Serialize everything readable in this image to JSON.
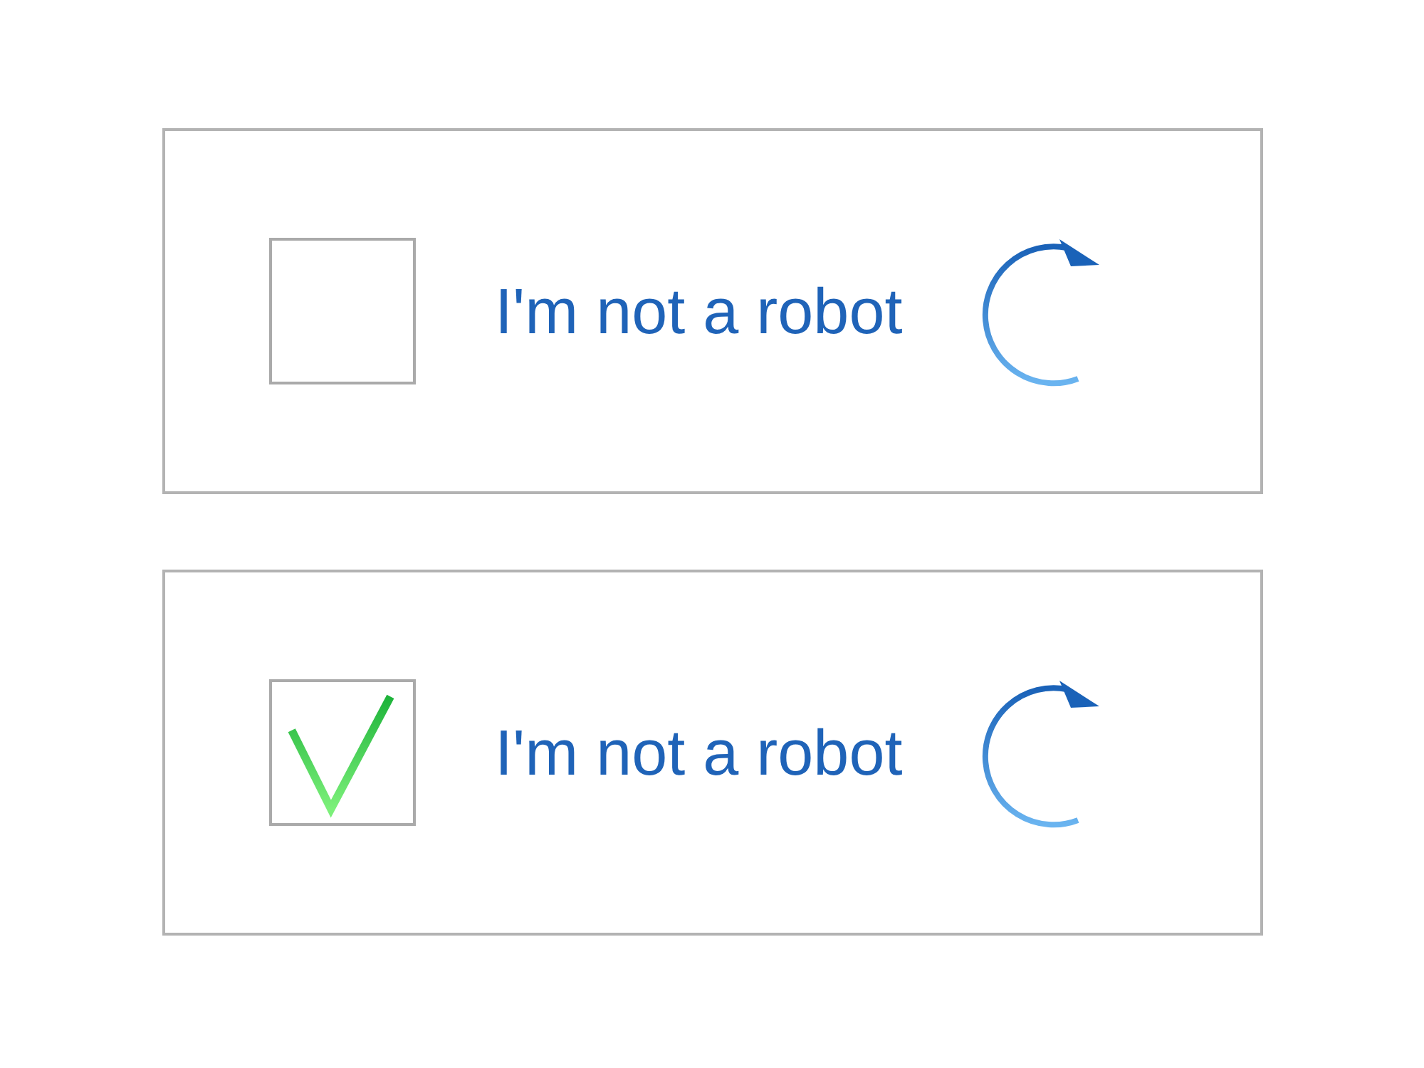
{
  "captchas": [
    {
      "label": "I'm not a robot",
      "checked": false
    },
    {
      "label": "I'm not a robot",
      "checked": true
    }
  ]
}
